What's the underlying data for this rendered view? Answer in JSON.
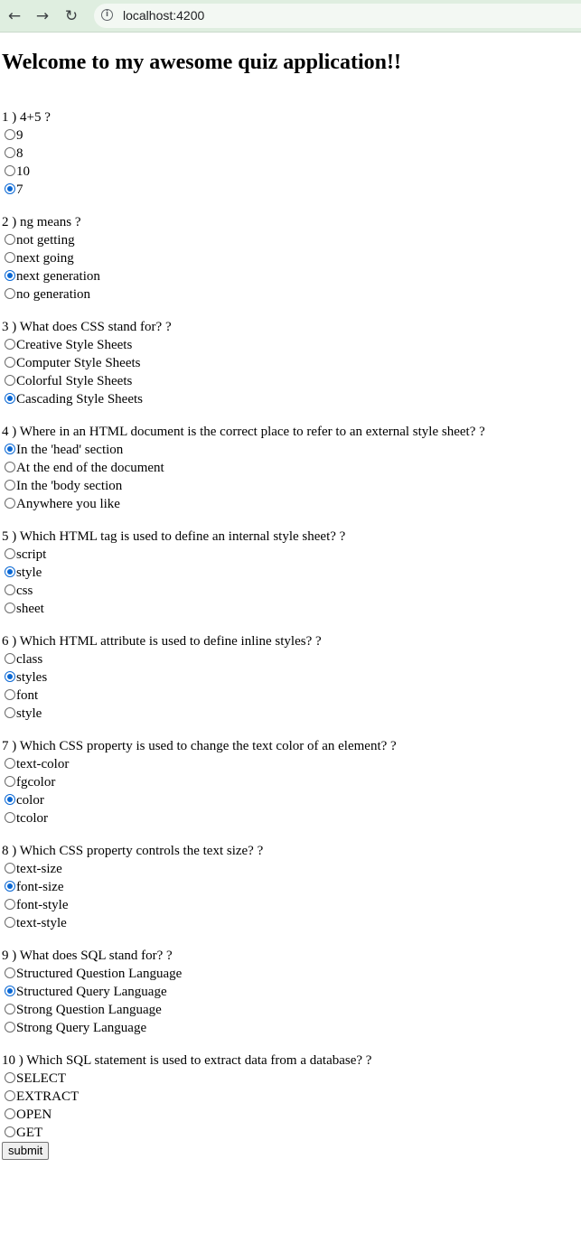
{
  "browser": {
    "url": "localhost:4200",
    "back_icon": "←",
    "forward_icon": "→",
    "reload_icon": "↻",
    "info_icon": "i"
  },
  "page": {
    "title": "Welcome to my awesome quiz application!!",
    "submit_label": "submit"
  },
  "questions": [
    {
      "text": "1 ) 4+5 ?",
      "options": [
        "9",
        "8",
        "10",
        "7"
      ],
      "selected": 3
    },
    {
      "text": "2 ) ng means ?",
      "options": [
        "not getting",
        "next going",
        "next generation",
        "no generation"
      ],
      "selected": 2
    },
    {
      "text": "3 ) What does CSS stand for? ?",
      "options": [
        "Creative Style Sheets",
        "Computer Style Sheets",
        "Colorful Style Sheets",
        "Cascading Style Sheets"
      ],
      "selected": 3
    },
    {
      "text": "4 ) Where in an HTML document is the correct place to refer to an external style sheet? ?",
      "options": [
        "In the 'head' section",
        "At the end of the document",
        "In the 'body section",
        "Anywhere you like"
      ],
      "selected": 0
    },
    {
      "text": "5 ) Which HTML tag is used to define an internal style sheet? ?",
      "options": [
        "script",
        "style",
        "css",
        "sheet"
      ],
      "selected": 1
    },
    {
      "text": "6 ) Which HTML attribute is used to define inline styles? ?",
      "options": [
        "class",
        "styles",
        "font",
        "style"
      ],
      "selected": 1
    },
    {
      "text": "7 ) Which CSS property is used to change the text color of an element? ?",
      "options": [
        "text-color",
        "fgcolor",
        "color",
        "tcolor"
      ],
      "selected": 2
    },
    {
      "text": "8 ) Which CSS property controls the text size? ?",
      "options": [
        "text-size",
        "font-size",
        "font-style",
        "text-style"
      ],
      "selected": 1
    },
    {
      "text": "9 ) What does SQL stand for? ?",
      "options": [
        "Structured Question Language",
        "Structured Query Language",
        "Strong Question Language",
        "Strong Query Language"
      ],
      "selected": 1
    },
    {
      "text": "10 ) Which SQL statement is used to extract data from a database? ?",
      "options": [
        "SELECT",
        "EXTRACT",
        "OPEN",
        "GET"
      ],
      "selected": null
    }
  ],
  "colors": {
    "chrome_bg": "#dfeee0",
    "radio_checked": "#0b68d4"
  }
}
